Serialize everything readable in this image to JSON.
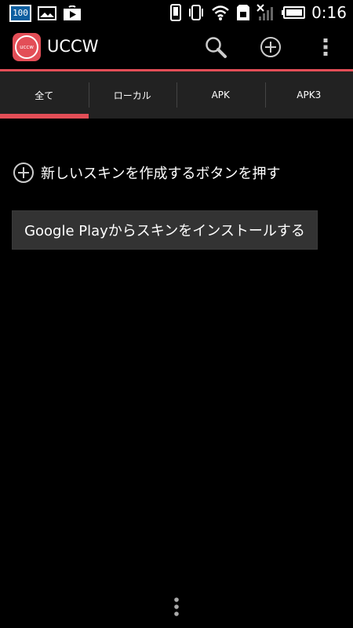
{
  "status_bar": {
    "badge": "100",
    "time": "0:16",
    "icons": [
      "sdcard-badge-icon",
      "image-icon",
      "play-store-icon",
      "phone-icon",
      "vibrate-icon",
      "wifi-icon",
      "sim-icon",
      "no-signal-icon",
      "battery-icon"
    ]
  },
  "app_bar": {
    "title": "UCCW",
    "logo_text": "uccw",
    "actions": [
      "search-icon",
      "add-icon",
      "overflow-menu-icon"
    ]
  },
  "tabs": [
    {
      "label": "全て",
      "selected": true
    },
    {
      "label": "ローカル",
      "selected": false
    },
    {
      "label": "APK",
      "selected": false
    },
    {
      "label": "APK3",
      "selected": false
    }
  ],
  "main": {
    "create_text": "新しいスキンを作成するボタンを押す",
    "google_play_button": "Google Playからスキンをインストールする"
  },
  "colors": {
    "accent": "#e34e57",
    "tab_bar": "#222222",
    "button": "#333333"
  }
}
